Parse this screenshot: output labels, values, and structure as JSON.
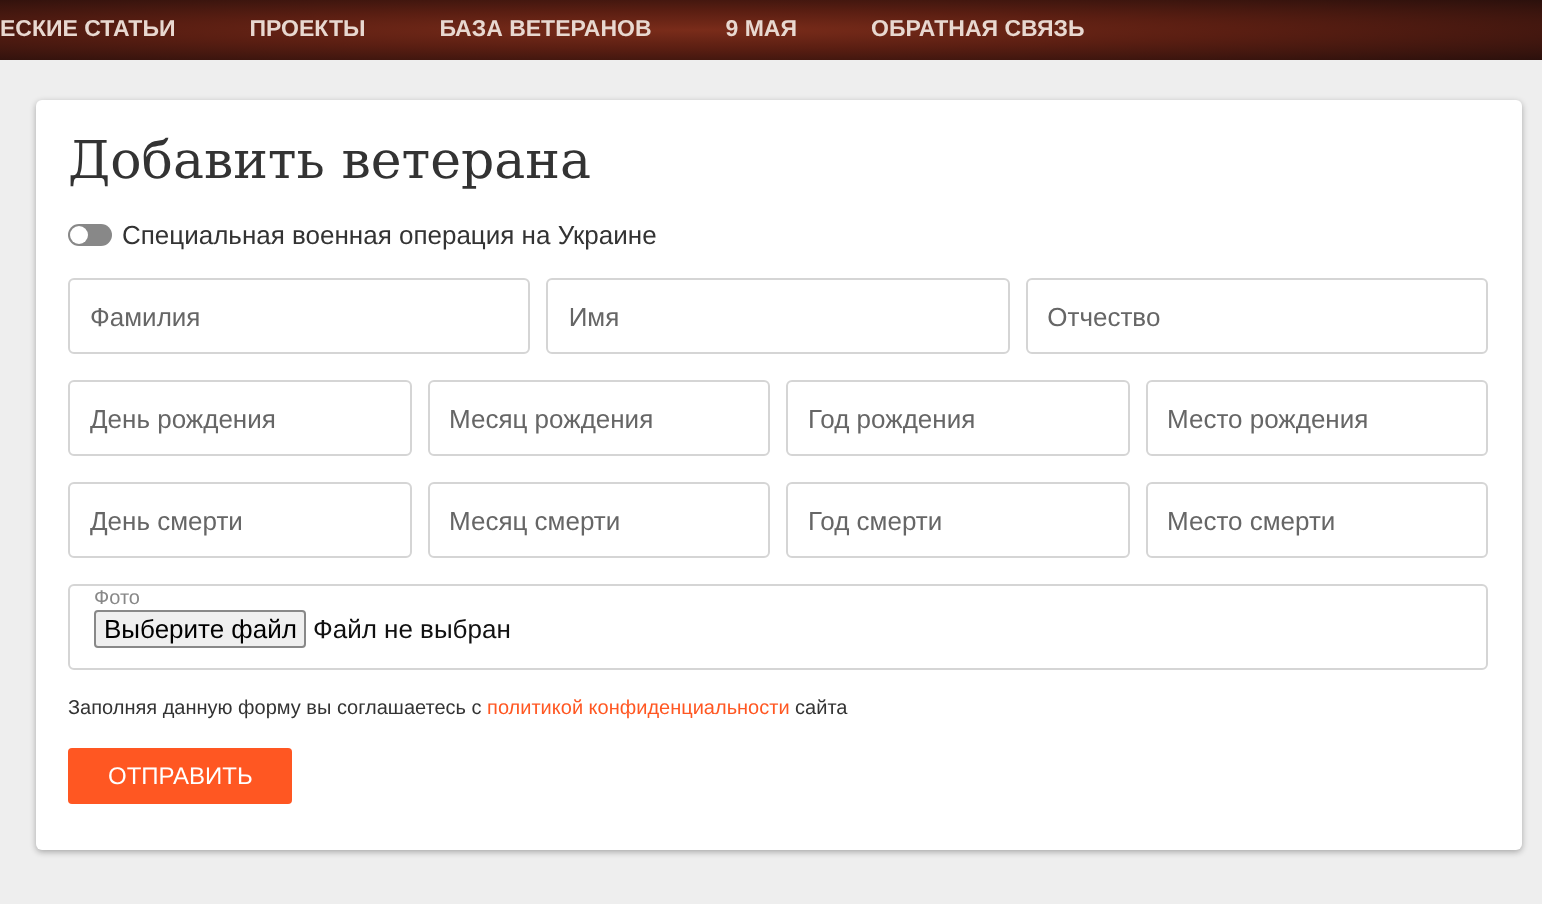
{
  "nav": {
    "items": [
      {
        "label": "ЕСКИЕ СТАТЬИ"
      },
      {
        "label": "ПРОЕКТЫ"
      },
      {
        "label": "БАЗА ВЕТЕРАНОВ"
      },
      {
        "label": "9 МАЯ"
      },
      {
        "label": "ОБРАТНАЯ СВЯЗЬ"
      }
    ]
  },
  "form": {
    "title": "Добавить ветерана",
    "toggle": {
      "label": "Специальная военная операция на Украине",
      "on": false
    },
    "rows": [
      [
        {
          "placeholder": "Фамилия"
        },
        {
          "placeholder": "Имя"
        },
        {
          "placeholder": "Отчество"
        }
      ],
      [
        {
          "placeholder": "День рождения"
        },
        {
          "placeholder": "Месяц рождения"
        },
        {
          "placeholder": "Год рождения"
        },
        {
          "placeholder": "Место рождения"
        }
      ],
      [
        {
          "placeholder": "День смерти"
        },
        {
          "placeholder": "Месяц смерти"
        },
        {
          "placeholder": "Год смерти"
        },
        {
          "placeholder": "Место смерти"
        }
      ]
    ],
    "photo": {
      "label": "Фото",
      "button": "Выберите файл",
      "status": "Файл не выбран"
    },
    "consent": {
      "before": "Заполняя данную форму вы соглашаетесь с ",
      "link": "политикой конфиденциальности",
      "after": " сайта"
    },
    "submit": "ОТПРАВИТЬ"
  }
}
